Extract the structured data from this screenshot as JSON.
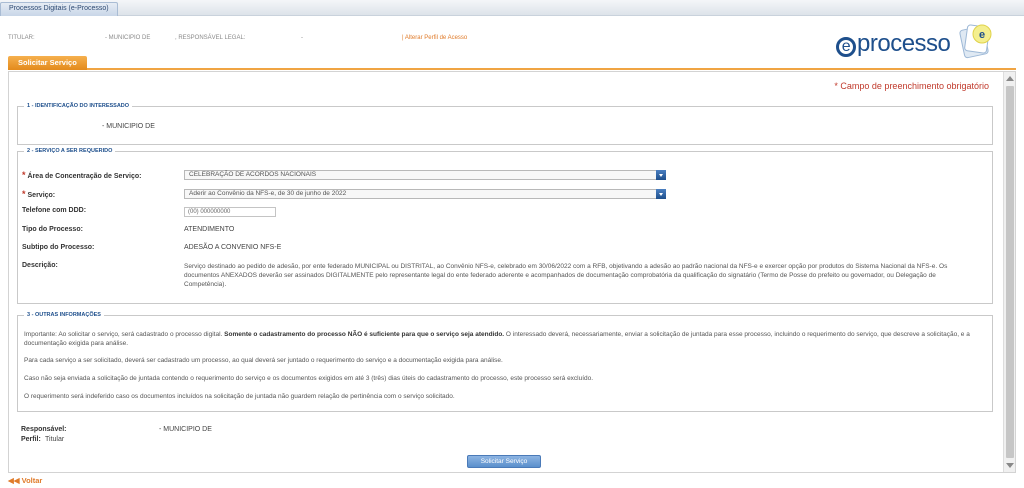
{
  "window": {
    "tab_title": "Processos Digitais (e-Processo)"
  },
  "header_info": {
    "titular_label": "TITULAR:",
    "municipio": "- MUNICIPIO DE",
    "responsavel_label": ", RESPONSÁVEL LEGAL:",
    "dash": "-",
    "alter_profile": "| Alterar Perfil de Acesso"
  },
  "logo": {
    "text": "processo",
    "e": "e"
  },
  "tab": {
    "label": "Solicitar Serviço"
  },
  "required_note": "* Campo de preenchimento obrigatório",
  "section1": {
    "legend": "1 - IDENTIFICAÇÃO DO INTERESSADO",
    "value": "- MUNICIPIO DE"
  },
  "section2": {
    "legend": "2 - SERVIÇO A SER REQUERIDO",
    "area_label": "Área de Concentração de Serviço:",
    "area_value": "CELEBRAÇÃO DE ACORDOS NACIONAIS",
    "servico_label": "Serviço:",
    "servico_value": "Aderir ao Convênio da NFS-e, de 30 de junho de 2022",
    "telefone_label": "Telefone com DDD:",
    "telefone_value": "(00) 000000000",
    "tipo_label": "Tipo do Processo:",
    "tipo_value": "ATENDIMENTO",
    "subtipo_label": "Subtipo do Processo:",
    "subtipo_value": "ADESÃO A CONVENIO NFS-E",
    "descricao_label": "Descrição:",
    "descricao_value": "Serviço destinado ao pedido de adesão, por ente federado MUNICIPAL ou DISTRITAL, ao Convênio NFS-e, celebrado em 30/06/2022 com a RFB, objetivando a adesão ao padrão nacional da NFS-e e exercer opção por produtos do Sistema Nacional da NFS-e. Os documentos ANEXADOS deverão ser assinados DIGITALMENTE pelo representante legal do ente federado aderente e acompanhados de documentação comprobatória da qualificação do signatário (Termo de Posse do prefeito ou governador, ou Delegação de Competência)."
  },
  "section3": {
    "legend": "3 - OUTRAS INFORMAÇÕES",
    "p1_a": "Importante: Ao solicitar o serviço, será cadastrado o processo digital. ",
    "p1_b": "Somente o cadastramento do processo NÃO é suficiente para que o serviço seja atendido.",
    "p1_c": " O interessado deverá, necessariamente, enviar a solicitação de juntada para esse processo, incluindo o requerimento do serviço, que descreve a solicitação, e a documentação exigida para análise.",
    "p2": "Para cada serviço a ser solicitado, deverá ser cadastrado um processo, ao qual deverá ser juntado o requerimento do serviço e a documentação exigida para análise.",
    "p3": "Caso não seja enviada a solicitação de juntada contendo o requerimento do serviço e os documentos exigidos em até 3 (três) dias úteis do cadastramento do processo, este processo será excluído.",
    "p4": "O requerimento será indeferido caso os documentos incluídos na solicitação de juntada não guardem relação de pertinência com o serviço solicitado."
  },
  "footer_info": {
    "responsavel_label": "Responsável:",
    "responsavel_value": "- MUNICIPIO DE",
    "perfil_label": "Perfil:",
    "perfil_value": "Titular"
  },
  "submit_label": "Solicitar Serviço",
  "back_label": "◀◀ Voltar",
  "colors": {
    "accent_orange": "#f0a443",
    "link_blue": "#1e4f8c",
    "required_red": "#c0392b"
  }
}
